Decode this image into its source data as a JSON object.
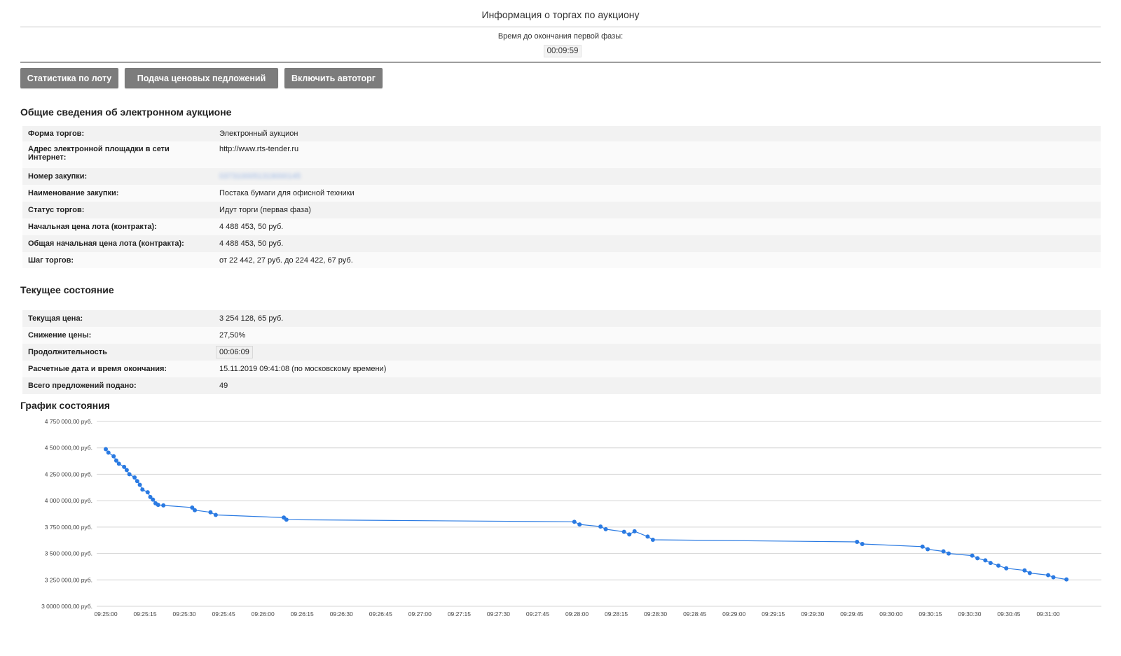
{
  "page": {
    "title": "Информация о торгах по аукциону"
  },
  "timer": {
    "label": "Время до окончания первой фазы:",
    "value": "00:09:59"
  },
  "toolbar": {
    "stats_label": "Статистика по лоту",
    "bids_label": "Подача ценовых педложений",
    "autotrade_label": "Включить автоторг"
  },
  "general": {
    "heading": "Общие сведения об электронном аукционе",
    "rows": [
      {
        "key": "Форма торгов:",
        "value": "Электронный аукцион"
      },
      {
        "key": "Адрес электронной площадки в сети Интернет:",
        "value": "http://www.rts-tender.ru"
      },
      {
        "key": "Номер закупки:",
        "value": "0373100051319000145"
      },
      {
        "key": "Наименование закупки:",
        "value": "Постака бумаги для офисной техники"
      },
      {
        "key": "Статус торгов:",
        "value": "Идут торги (первая фаза)"
      },
      {
        "key": "Начальная цена лота (контракта):",
        "value": "4 488 453, 50 руб."
      },
      {
        "key": "Общая начальная цена лота (контракта):",
        "value": "4 488 453, 50 руб."
      },
      {
        "key": "Шаг торгов:",
        "value": "от 22 442, 27 руб. до 224 422, 67 руб."
      }
    ]
  },
  "current": {
    "heading": "Текущее состояние",
    "rows": [
      {
        "key": "Текущая цена:",
        "value": "3 254 128, 65 руб."
      },
      {
        "key": "Снижение цены:",
        "value": "27,50%"
      },
      {
        "key": "Продолжительность",
        "value": "00:06:09"
      },
      {
        "key": "Расчетные дата и время окончания:",
        "value": "15.11.2019 09:41:08 (по московскому времени)"
      },
      {
        "key": "Всего предложений подано:",
        "value": "49"
      }
    ]
  },
  "chart_section": {
    "heading": "График состояния"
  },
  "chart_data": {
    "type": "line",
    "title": "График состояния",
    "xlabel": "",
    "ylabel": "",
    "color": "#2a7ae2",
    "grid": true,
    "ylim": [
      3000000,
      4750000
    ],
    "xlim": [
      "09:25:00",
      "09:31:10"
    ],
    "y_ticks": [
      {
        "value": 4750000,
        "label": "4 750 000,00 руб."
      },
      {
        "value": 4500000,
        "label": "4 500 000,00 руб."
      },
      {
        "value": 4250000,
        "label": "4 250 000,00 руб."
      },
      {
        "value": 4000000,
        "label": "4 000 000,00 руб."
      },
      {
        "value": 3750000,
        "label": "3 750 000,00 руб."
      },
      {
        "value": 3500000,
        "label": "3 500 000,00 руб."
      },
      {
        "value": 3250000,
        "label": "3 250 000,00 руб."
      },
      {
        "value": 3000000,
        "label": "3 0000 000,00 руб."
      }
    ],
    "x_ticks": [
      "09:25:00",
      "09:25:15",
      "09:25:30",
      "09:25:45",
      "09:26:00",
      "09:26:15",
      "09:26:30",
      "09:26:45",
      "09:27:00",
      "09:27:15",
      "09:27:30",
      "09:27:45",
      "09:28:00",
      "09:28:15",
      "09:28:30",
      "09:28:45",
      "09:29:00",
      "09:29:15",
      "09:29:30",
      "09:29:45",
      "09:30:00",
      "09:30:15",
      "09:30:30",
      "09:30:45",
      "09:31:00"
    ],
    "points": [
      {
        "x": "09:25:00",
        "y": 4488453
      },
      {
        "x": "09:25:01",
        "y": 4455000
      },
      {
        "x": "09:25:03",
        "y": 4420000
      },
      {
        "x": "09:25:04",
        "y": 4380000
      },
      {
        "x": "09:25:05",
        "y": 4350000
      },
      {
        "x": "09:25:07",
        "y": 4320000
      },
      {
        "x": "09:25:08",
        "y": 4290000
      },
      {
        "x": "09:25:09",
        "y": 4250000
      },
      {
        "x": "09:25:11",
        "y": 4220000
      },
      {
        "x": "09:25:12",
        "y": 4185000
      },
      {
        "x": "09:25:13",
        "y": 4150000
      },
      {
        "x": "09:25:14",
        "y": 4105000
      },
      {
        "x": "09:25:16",
        "y": 4080000
      },
      {
        "x": "09:25:17",
        "y": 4035000
      },
      {
        "x": "09:25:18",
        "y": 4010000
      },
      {
        "x": "09:25:19",
        "y": 3975000
      },
      {
        "x": "09:25:20",
        "y": 3960000
      },
      {
        "x": "09:25:22",
        "y": 3955000
      },
      {
        "x": "09:25:33",
        "y": 3935000
      },
      {
        "x": "09:25:34",
        "y": 3910000
      },
      {
        "x": "09:25:40",
        "y": 3890000
      },
      {
        "x": "09:25:42",
        "y": 3865000
      },
      {
        "x": "09:26:08",
        "y": 3840000
      },
      {
        "x": "09:26:09",
        "y": 3820000
      },
      {
        "x": "09:27:59",
        "y": 3800000
      },
      {
        "x": "09:28:01",
        "y": 3775000
      },
      {
        "x": "09:28:09",
        "y": 3755000
      },
      {
        "x": "09:28:11",
        "y": 3730000
      },
      {
        "x": "09:28:18",
        "y": 3705000
      },
      {
        "x": "09:28:20",
        "y": 3680000
      },
      {
        "x": "09:28:22",
        "y": 3710000
      },
      {
        "x": "09:28:27",
        "y": 3660000
      },
      {
        "x": "09:28:29",
        "y": 3630000
      },
      {
        "x": "09:29:47",
        "y": 3610000
      },
      {
        "x": "09:29:49",
        "y": 3590000
      },
      {
        "x": "09:30:12",
        "y": 3565000
      },
      {
        "x": "09:30:14",
        "y": 3540000
      },
      {
        "x": "09:30:20",
        "y": 3520000
      },
      {
        "x": "09:30:22",
        "y": 3500000
      },
      {
        "x": "09:30:31",
        "y": 3480000
      },
      {
        "x": "09:30:33",
        "y": 3455000
      },
      {
        "x": "09:30:36",
        "y": 3435000
      },
      {
        "x": "09:30:38",
        "y": 3410000
      },
      {
        "x": "09:30:41",
        "y": 3385000
      },
      {
        "x": "09:30:44",
        "y": 3360000
      },
      {
        "x": "09:30:51",
        "y": 3340000
      },
      {
        "x": "09:30:53",
        "y": 3315000
      },
      {
        "x": "09:31:00",
        "y": 3295000
      },
      {
        "x": "09:31:02",
        "y": 3275000
      },
      {
        "x": "09:31:07",
        "y": 3254129
      }
    ]
  }
}
